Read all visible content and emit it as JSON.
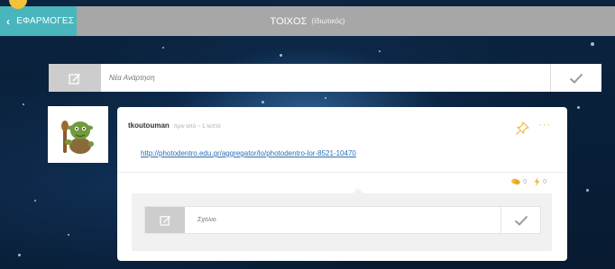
{
  "topbar": {
    "apps_label": "ΕΦΑΡΜΟΓΕΣ",
    "title": "ΤΟΙΧΟΣ",
    "subtitle": "(Ιδιωτικός)"
  },
  "new_post": {
    "placeholder": "Νέα Ανάρτηση"
  },
  "post": {
    "author": "tkoutouman",
    "time": "πριν από ~ 1 λεπτό",
    "link": "http://photodentro.edu.gr/aggregator/lo/photodentro-lor-8521-10470",
    "comments_count": "0",
    "likes_count": "0"
  },
  "comment": {
    "placeholder": "Σχόλιο"
  },
  "colors": {
    "apps_bg": "#49b6be",
    "topbar_bg": "#a7a7a7",
    "accent": "#f4b93a",
    "link": "#2a6fb3"
  },
  "icons": [
    "chevron-left-icon",
    "edit-icon",
    "check-icon",
    "pin-icon",
    "more-icon",
    "comment-icon",
    "bolt-icon"
  ]
}
